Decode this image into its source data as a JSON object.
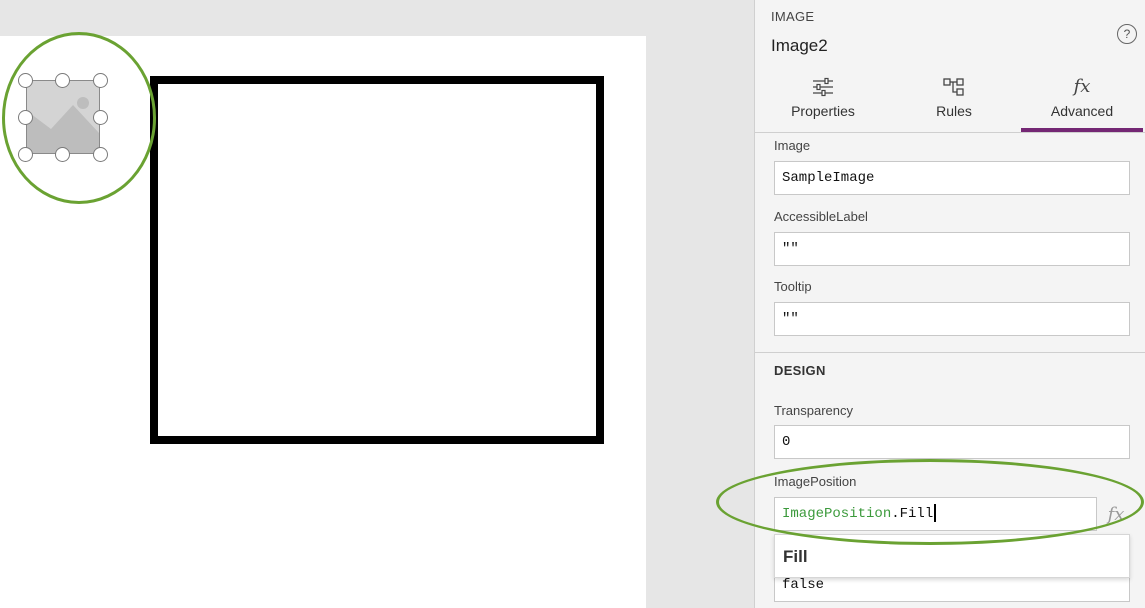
{
  "canvas": {
    "image_control_icon": "image-placeholder-icon"
  },
  "panel": {
    "control_type": "IMAGE",
    "control_name": "Image2",
    "help_glyph": "?",
    "tabs": [
      {
        "label": "Properties",
        "icon": "sliders-icon"
      },
      {
        "label": "Rules",
        "icon": "rules-icon"
      },
      {
        "label": "Advanced",
        "icon": "fx-icon",
        "glyph": "fx",
        "active": true
      }
    ],
    "fields": {
      "image": {
        "label": "Image",
        "value": "SampleImage"
      },
      "accessible_label": {
        "label": "AccessibleLabel",
        "value": "\"\""
      },
      "tooltip": {
        "label": "Tooltip",
        "value": "\"\""
      }
    },
    "design_section": "DESIGN",
    "transparency": {
      "label": "Transparency",
      "value": "0"
    },
    "image_position": {
      "label": "ImagePosition",
      "keyword": "ImagePosition",
      "suffix": ".Fill"
    },
    "fx_glyph": "fx",
    "suggestion": "Fill",
    "next_field_value": "false"
  },
  "colors": {
    "accent_tab": "#742774",
    "highlight": "#6aa232",
    "keyword": "#3c9a3c"
  }
}
